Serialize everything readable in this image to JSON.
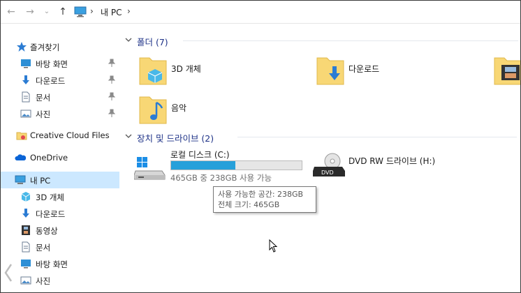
{
  "address": {
    "crumb": "내 PC",
    "sep1": "›",
    "sep2": "›"
  },
  "sidebar": {
    "quick_access": "즐겨찾기",
    "quick_items": [
      "바탕 화면",
      "다운로드",
      "문서",
      "사진"
    ],
    "creative_cloud": "Creative Cloud Files",
    "onedrive": "OneDrive",
    "this_pc": "내 PC",
    "pc_items": [
      "3D 개체",
      "다운로드",
      "동영상",
      "문서",
      "바탕 화면",
      "사진"
    ]
  },
  "folders_group": {
    "title": "폴더 (7)",
    "items": [
      "3D 개체",
      "다운로드",
      "음악"
    ]
  },
  "drives_group": {
    "title": "장치 및 드라이브 (2)",
    "local": {
      "name": "로컬 디스크 (C:)",
      "space": "465GB 중 238GB 사용 가능",
      "used_fraction": 0.49
    },
    "dvd": {
      "name": "DVD RW 드라이브 (H:)",
      "badge": "DVD"
    }
  },
  "tooltip": {
    "line1": "사용 가능한 공간: 238GB",
    "line2": "전체 크기: 465GB"
  },
  "colors": {
    "selected_bg": "#cce8ff",
    "group_title": "#1e3287",
    "bar_fill": "#26a0da",
    "folder": "#f8d775"
  }
}
